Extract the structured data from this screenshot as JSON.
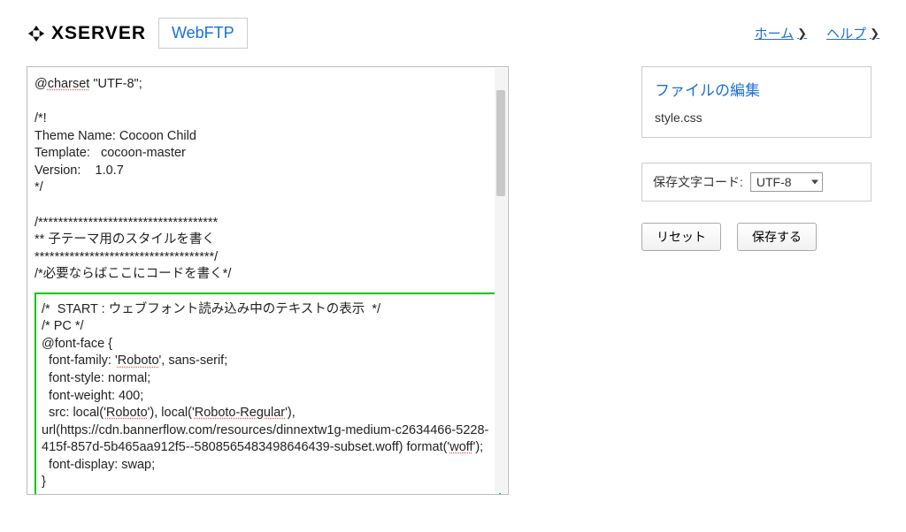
{
  "header": {
    "brand": "XSERVER",
    "product": "WebFTP",
    "links": {
      "home": "ホーム",
      "help": "ヘルプ"
    }
  },
  "editor": {
    "top": "@charset \"UTF-8\";\n\n/*!\nTheme Name: Cocoon Child\nTemplate:   cocoon-master\nVersion:    1.0.7\n*/\n\n/************************************\n** 子テーマ用のスタイルを書く\n************************************/\n/*必要ならばここにコードを書く*/",
    "highlight": "/*  START : ウェブフォント読み込み中のテキストの表示  */\n/* PC */\n@font-face {\n  font-family: 'Roboto', sans-serif;\n  font-style: normal;\n  font-weight: 400;\n  src: local('Roboto'), local('Roboto-Regular'),\nurl(https://cdn.bannerflow.com/resources/dinnextw1g-medium-c2634466-5228-415f-857d-5b465aa912f5--5808565483498646439-subset.woff) format('woff');\n  font-display: swap;\n}"
  },
  "sidebar": {
    "panel_title": "ファイルの編集",
    "filename": "style.css",
    "encoding_label": "保存文字コード:",
    "encoding_value": "UTF-8",
    "reset_label": "リセット",
    "save_label": "保存する"
  }
}
